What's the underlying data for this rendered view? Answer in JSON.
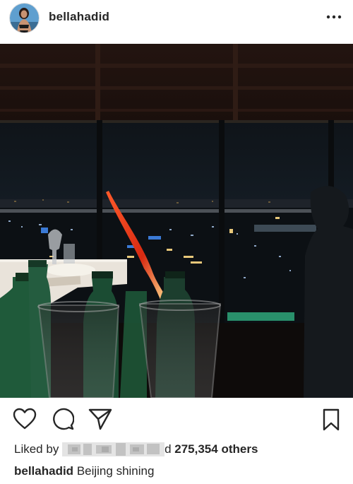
{
  "post": {
    "username": "bellahadid",
    "likes_prefix": "Liked by",
    "likes_redacted_tail": "d",
    "likes_count": "275,354 others",
    "caption_user": "bellahadid",
    "caption_text": "Beijing shining"
  },
  "icons": {
    "more": "more-options-icon",
    "like": "heart-icon",
    "comment": "comment-bubble-icon",
    "share": "paper-plane-icon",
    "save": "bookmark-icon"
  },
  "colors": {
    "text": "#262626",
    "photo_dark": "#120d0c",
    "city_red": "#ff3b1f",
    "bottle_green": "#1f5a3a"
  }
}
